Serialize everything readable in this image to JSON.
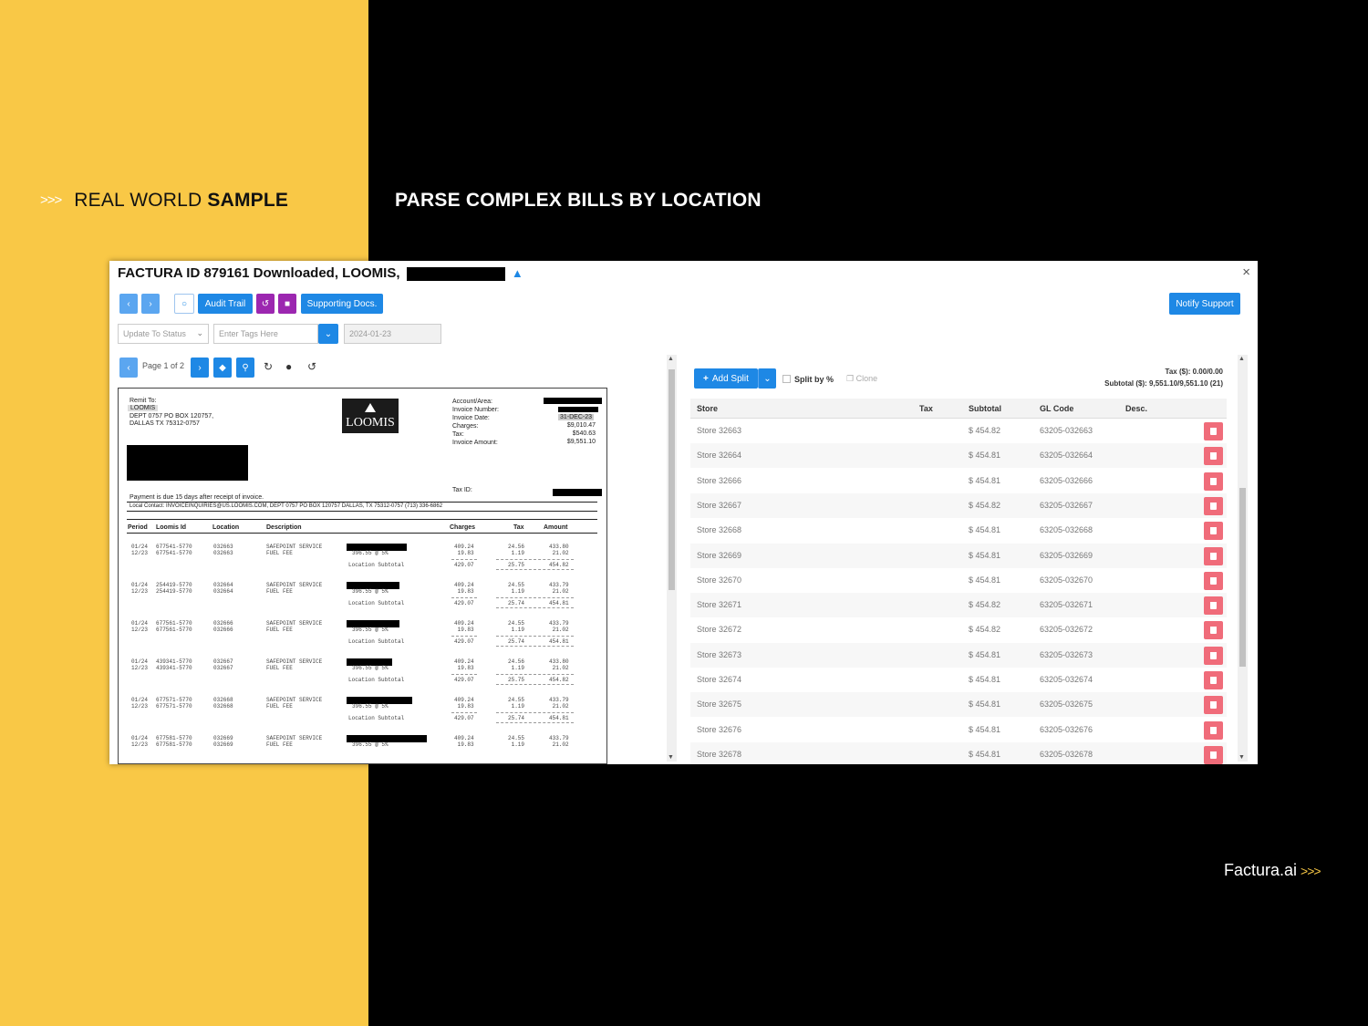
{
  "slide": {
    "left_prefix": ">>>",
    "left_title_plain": "REAL WORLD ",
    "left_title_bold": "SAMPLE",
    "right_title": "PARSE COMPLEX BILLS BY LOCATION",
    "brand": "Factura.ai",
    "brand_suffix": ">>>",
    "colors": {
      "yellow": "#f9c846",
      "black": "#000000",
      "blue": "#1e88e5",
      "purple": "#9c27b0",
      "delete": "#f06c7a"
    }
  },
  "window": {
    "title": "FACTURA ID 879161 Downloaded, LOOMIS,",
    "close": "×",
    "toolbar": {
      "audit_trail": "Audit Trail",
      "supporting_docs": "Supporting Docs.",
      "notify_support": "Notify Support"
    },
    "status_placeholder": "Update To Status",
    "tags_placeholder": "Enter Tags Here",
    "date_value": "2024-01-23",
    "pager": "Page 1 of 2",
    "icons": [
      "chevron-left-icon",
      "chevron-right-icon",
      "comment-icon",
      "undo-icon",
      "lock-icon",
      "tag-icon",
      "zoom-icon",
      "rotate-icon",
      "record-icon",
      "reset-icon"
    ]
  },
  "invoice": {
    "remit_to_label": "Remit To:",
    "remit_name": "LOOMIS",
    "remit_addr1": "DEPT 0757 PO BOX 120757,",
    "remit_addr2": "DALLAS TX 75312-0757",
    "logo": "LOOMIS",
    "fields": [
      "Account/Area:",
      "Invoice Number:",
      "Invoice Date:",
      "Charges:",
      "Tax:",
      "Invoice Amount:"
    ],
    "values": {
      "invoice_date": "31-DEC-23",
      "charges": "$9,010.47",
      "tax": "$540.63",
      "amount": "$9,551.10"
    },
    "tax_id_label": "Tax ID:",
    "payment_note": "Payment is due 15 days after receipt of invoice.",
    "local_contact": "Local Contact: INVOICEINQUIRIES@US.LOOMIS.COM, DEPT 0757 PO BOX 120757 DALLAS, TX 75312-0757 (713) 336-6862",
    "headers": [
      "Period",
      "Loomis Id",
      "Location",
      "Description",
      "Charges",
      "Tax",
      "Amount"
    ],
    "groups": [
      {
        "p1": "01/24",
        "p2": "12/23",
        "id1": "677541-5770",
        "id2": "677541-5770",
        "loc": "032663",
        "charges": [
          "409.24",
          "19.83"
        ],
        "tax": [
          "24.56",
          "1.19"
        ],
        "amount": [
          "433.80",
          "21.02"
        ],
        "sub": [
          "429.07",
          "25.75",
          "454.82"
        ]
      },
      {
        "p1": "01/24",
        "p2": "12/23",
        "id1": "254419-5770",
        "id2": "254419-5770",
        "loc": "032664",
        "charges": [
          "409.24",
          "19.83"
        ],
        "tax": [
          "24.55",
          "1.19"
        ],
        "amount": [
          "433.79",
          "21.02"
        ],
        "sub": [
          "429.07",
          "25.74",
          "454.81"
        ]
      },
      {
        "p1": "01/24",
        "p2": "12/23",
        "id1": "677561-5770",
        "id2": "677561-5770",
        "loc": "032666",
        "charges": [
          "409.24",
          "19.83"
        ],
        "tax": [
          "24.55",
          "1.19"
        ],
        "amount": [
          "433.79",
          "21.02"
        ],
        "sub": [
          "429.07",
          "25.74",
          "454.81"
        ]
      },
      {
        "p1": "01/24",
        "p2": "12/23",
        "id1": "439341-5770",
        "id2": "439341-5770",
        "loc": "032667",
        "charges": [
          "409.24",
          "19.83"
        ],
        "tax": [
          "24.56",
          "1.19"
        ],
        "amount": [
          "433.80",
          "21.02"
        ],
        "sub": [
          "429.07",
          "25.75",
          "454.82"
        ]
      },
      {
        "p1": "01/24",
        "p2": "12/23",
        "id1": "677571-5770",
        "id2": "677571-5770",
        "loc": "032668",
        "charges": [
          "409.24",
          "19.83"
        ],
        "tax": [
          "24.55",
          "1.19"
        ],
        "amount": [
          "433.79",
          "21.02"
        ],
        "sub": [
          "429.07",
          "25.74",
          "454.81"
        ]
      },
      {
        "p1": "01/24",
        "p2": "12/23",
        "id1": "677581-5770",
        "id2": "677581-5770",
        "loc": "032669",
        "charges": [
          "409.24",
          "19.83"
        ],
        "tax": [
          "24.55",
          "1.19"
        ],
        "amount": [
          "433.79",
          "21.02"
        ],
        "sub": null
      }
    ],
    "desc1": "SAFEPOINT SERVICE",
    "desc2": "FUEL FEE",
    "rate": "396.55 @ 5%",
    "subtotal_label": "Location Subtotal"
  },
  "split": {
    "add_split": "Add Split",
    "split_by_pct": "Split by %",
    "clone": "Clone",
    "tax_summary": "Tax ($): 0.00/0.00",
    "subtotal_summary": "Subtotal ($): 9,551.10/9,551.10 (21)",
    "columns": [
      "Store",
      "Tax",
      "Subtotal",
      "GL Code",
      "Desc."
    ],
    "rows": [
      {
        "store": "Store 32663",
        "subtotal": "$ 454.82",
        "gl": "63205-032663"
      },
      {
        "store": "Store 32664",
        "subtotal": "$ 454.81",
        "gl": "63205-032664"
      },
      {
        "store": "Store 32666",
        "subtotal": "$ 454.81",
        "gl": "63205-032666"
      },
      {
        "store": "Store 32667",
        "subtotal": "$ 454.82",
        "gl": "63205-032667"
      },
      {
        "store": "Store 32668",
        "subtotal": "$ 454.81",
        "gl": "63205-032668"
      },
      {
        "store": "Store 32669",
        "subtotal": "$ 454.81",
        "gl": "63205-032669"
      },
      {
        "store": "Store 32670",
        "subtotal": "$ 454.81",
        "gl": "63205-032670"
      },
      {
        "store": "Store 32671",
        "subtotal": "$ 454.82",
        "gl": "63205-032671"
      },
      {
        "store": "Store 32672",
        "subtotal": "$ 454.82",
        "gl": "63205-032672"
      },
      {
        "store": "Store 32673",
        "subtotal": "$ 454.81",
        "gl": "63205-032673"
      },
      {
        "store": "Store 32674",
        "subtotal": "$ 454.81",
        "gl": "63205-032674"
      },
      {
        "store": "Store 32675",
        "subtotal": "$ 454.81",
        "gl": "63205-032675"
      },
      {
        "store": "Store 32676",
        "subtotal": "$ 454.81",
        "gl": "63205-032676"
      },
      {
        "store": "Store 32678",
        "subtotal": "$ 454.81",
        "gl": "63205-032678"
      }
    ]
  }
}
